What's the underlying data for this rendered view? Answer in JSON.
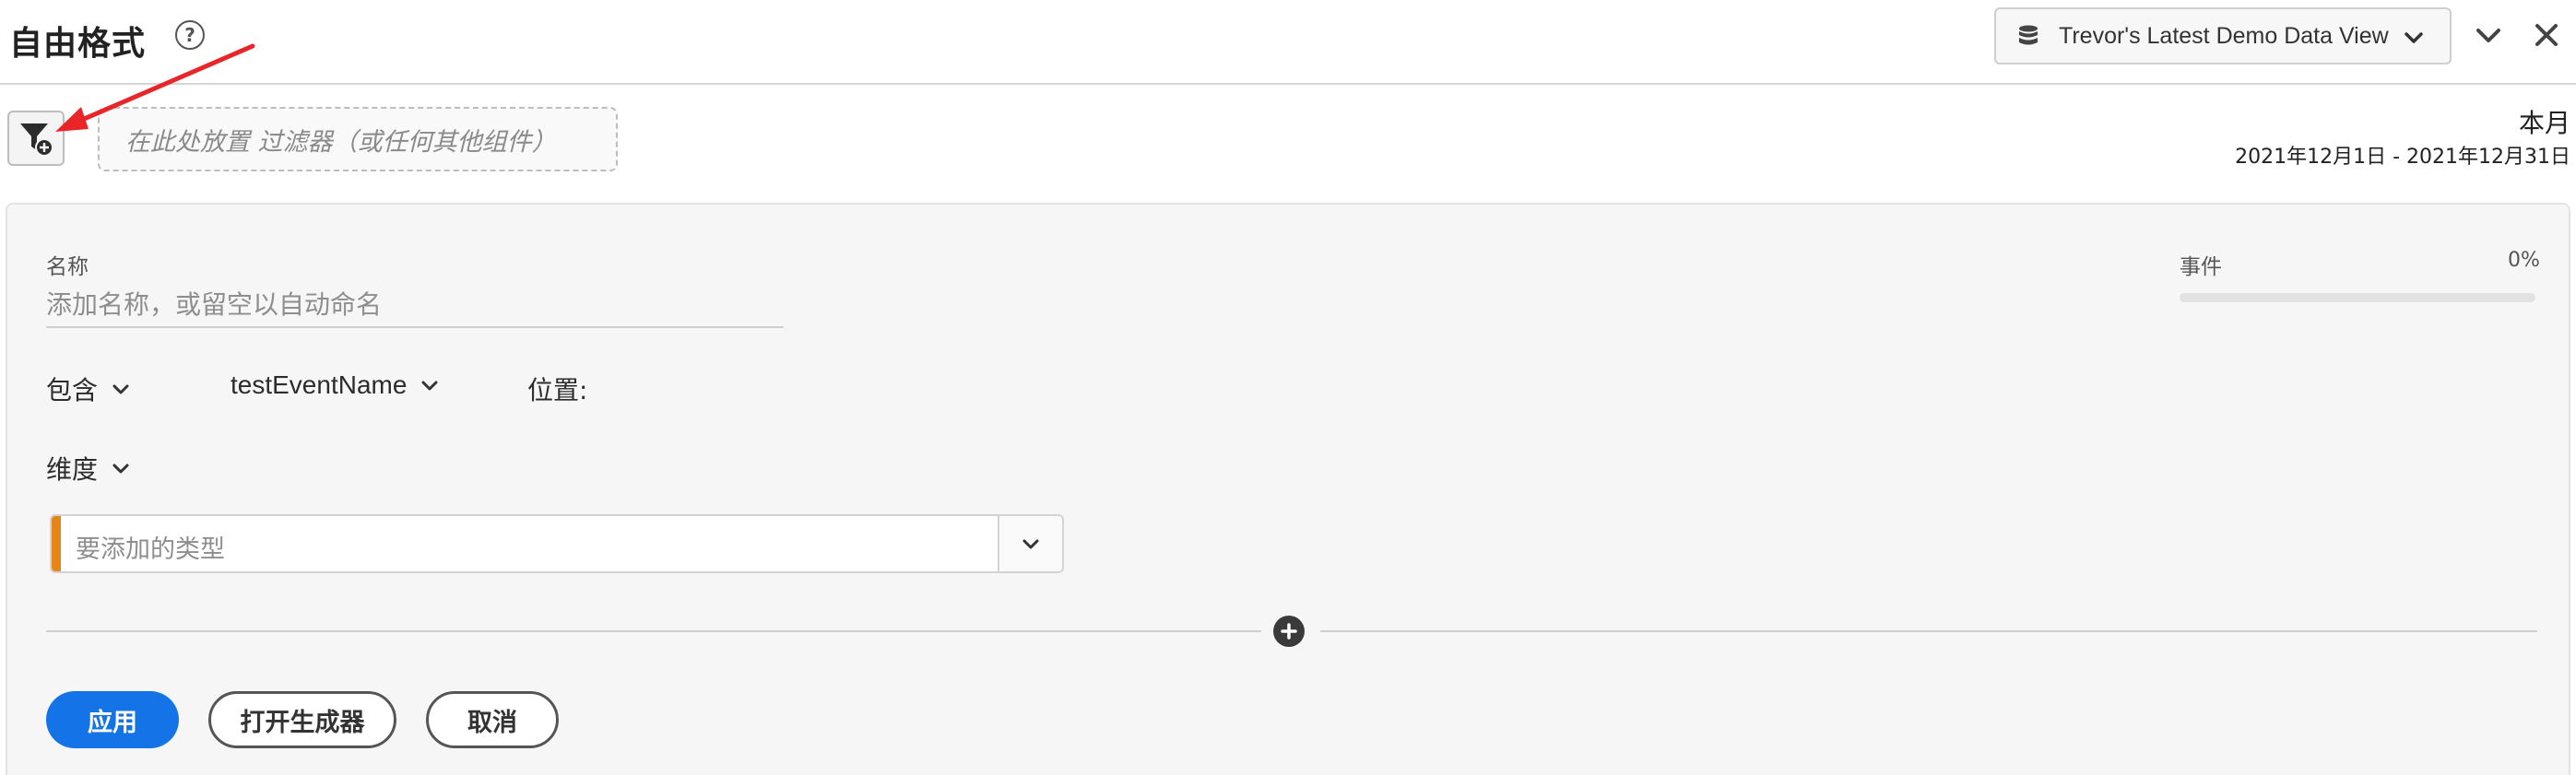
{
  "header": {
    "title": "自由格式",
    "help_icon": "?",
    "data_view": "Trevor's Latest Demo Data View"
  },
  "filter_bar": {
    "drop_zone_text": "在此处放置 过滤器（或任何其他组件）",
    "date_title": "本月",
    "date_range": "2021年12月1日 - 2021年12月31日"
  },
  "panel": {
    "name_label": "名称",
    "name_placeholder": "添加名称，或留空以自动命名",
    "events_label": "事件",
    "events_percent": "0%",
    "events_fraction": 0,
    "include_label": "包含",
    "event_name": "testEventName",
    "location_label": "位置:",
    "dimension_label": "维度",
    "type_placeholder": "要添加的类型",
    "accent_color": "#e68619"
  },
  "actions": {
    "apply": "应用",
    "open_builder": "打开生成器",
    "cancel": "取消"
  },
  "annotation": {
    "arrow_color": "#e8262a"
  },
  "icons": {
    "help": "help-icon",
    "data_view": "database-icon",
    "collapse": "chevron-down-icon",
    "close": "close-icon",
    "filter": "filter-add-icon",
    "add": "plus-circle-icon"
  }
}
